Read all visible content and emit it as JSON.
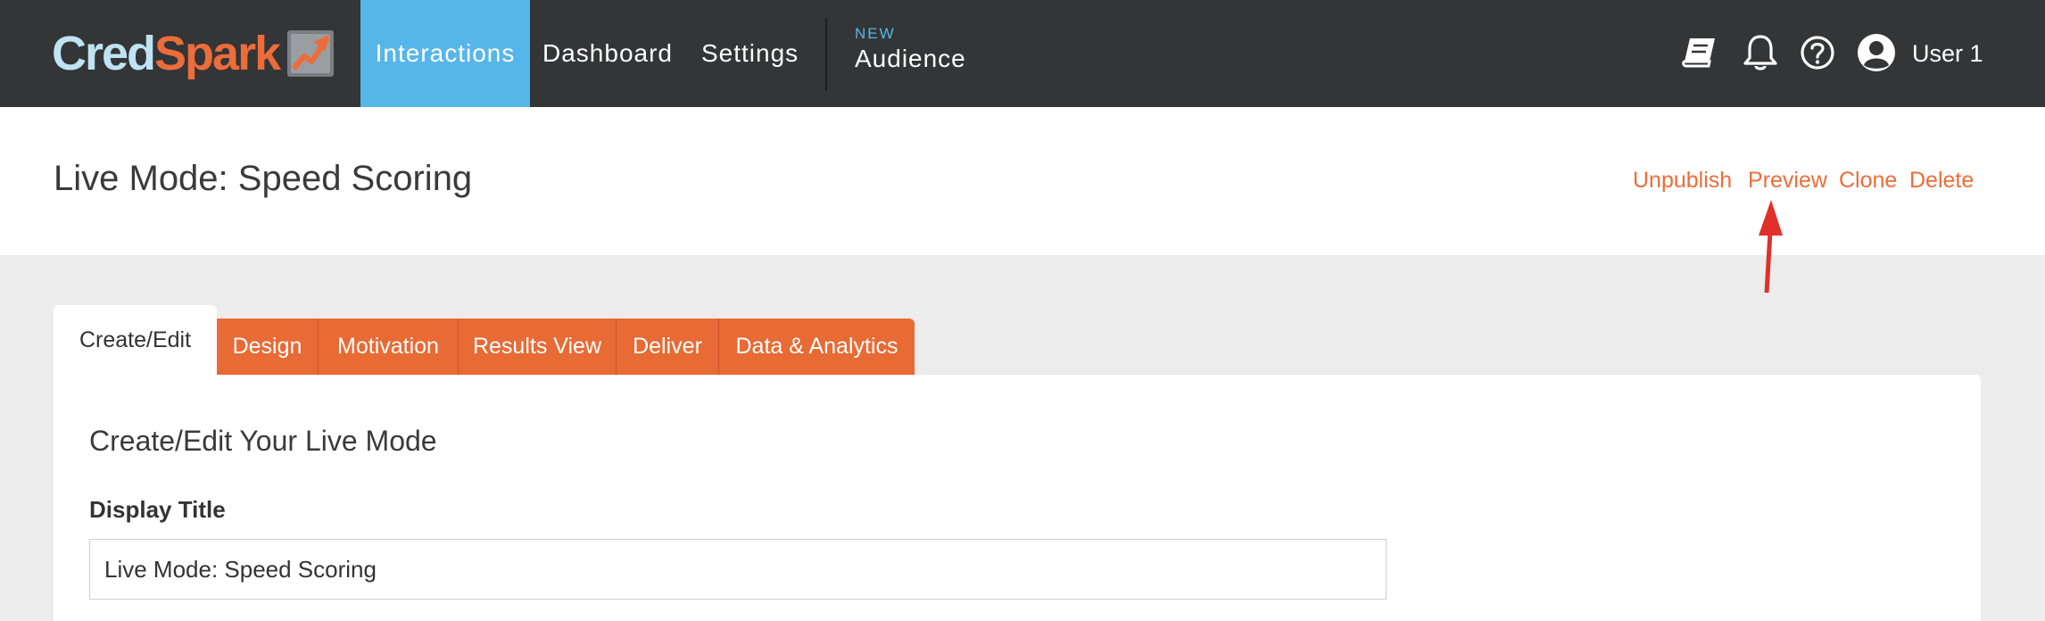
{
  "app": {
    "logo": {
      "part1": "Cred",
      "part2": "Spark"
    }
  },
  "nav": {
    "interactions": "Interactions",
    "dashboard": "Dashboard",
    "settings": "Settings",
    "audience_badge": "NEW",
    "audience": "Audience",
    "active": "Interactions"
  },
  "top_icons": [
    "book-icon",
    "bell-icon",
    "help-icon",
    "user-avatar-icon"
  ],
  "user": {
    "name": "User 1"
  },
  "header": {
    "title": "Live Mode: Speed Scoring",
    "actions": {
      "unpublish": "Unpublish",
      "preview": "Preview",
      "clone": "Clone",
      "delete": "Delete"
    }
  },
  "tabs": [
    {
      "label": "Create/Edit",
      "active": true
    },
    {
      "label": "Design",
      "active": false
    },
    {
      "label": "Motivation",
      "active": false
    },
    {
      "label": "Results View",
      "active": false
    },
    {
      "label": "Deliver",
      "active": false
    },
    {
      "label": "Data & Analytics",
      "active": false
    }
  ],
  "panel": {
    "heading": "Create/Edit Your Live Mode",
    "display_title_label": "Display Title",
    "display_title_value": "Live Mode: Speed Scoring"
  },
  "colors": {
    "topbar": "#333537",
    "active_nav": "#56b6ea",
    "accent_orange": "#e86a34",
    "action_link": "#ec6d3a",
    "annotation_arrow": "#e0302a",
    "page_background": "#ececec"
  }
}
